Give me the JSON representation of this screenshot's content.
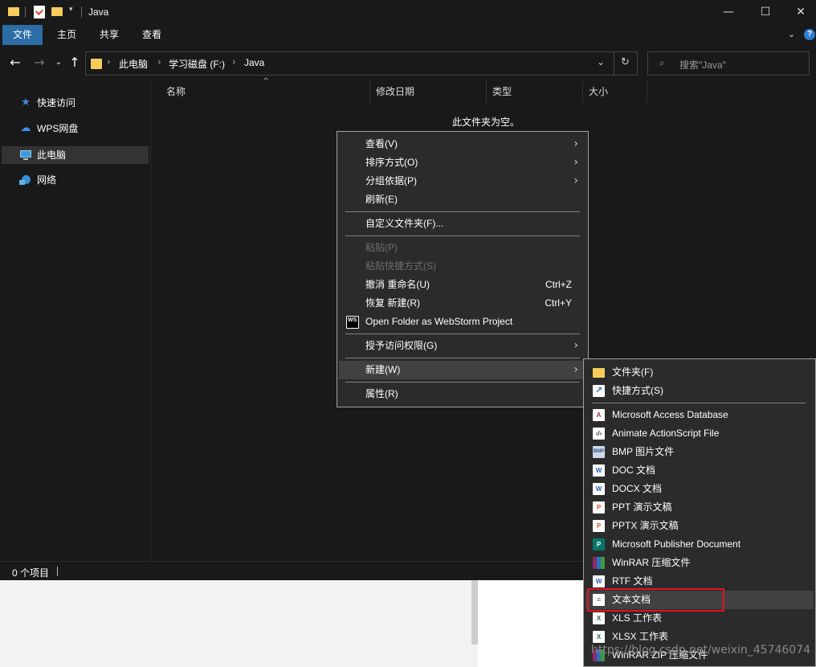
{
  "window": {
    "title": "Java"
  },
  "window_controls": {
    "minimize": "—",
    "maximize": "☐",
    "close": "✕"
  },
  "ribbon": {
    "tabs": [
      "文件",
      "主页",
      "共享",
      "查看"
    ]
  },
  "nav": {
    "breadcrumb": [
      "此电脑",
      "学习磁盘 (F:)",
      "Java"
    ],
    "search_placeholder": "搜索\"Java\""
  },
  "sidebar": {
    "items": [
      {
        "label": "快速访问",
        "icon": "star-icon"
      },
      {
        "label": "WPS网盘",
        "icon": "cloud-icon"
      },
      {
        "label": "此电脑",
        "icon": "computer-icon",
        "selected": true
      },
      {
        "label": "网络",
        "icon": "network-icon"
      }
    ]
  },
  "columns": [
    "名称",
    "修改日期",
    "类型",
    "大小"
  ],
  "empty_text": "此文件夹为空。",
  "status": {
    "count": "0 个项目"
  },
  "context_menu": {
    "items": [
      {
        "label": "查看(V)",
        "submenu": true
      },
      {
        "label": "排序方式(O)",
        "submenu": true
      },
      {
        "label": "分组依据(P)",
        "submenu": true
      },
      {
        "label": "刷新(E)"
      },
      {
        "label": "自定义文件夹(F)..."
      },
      {
        "label": "粘贴(P)",
        "disabled": true
      },
      {
        "label": "粘贴快捷方式(S)",
        "disabled": true
      },
      {
        "label": "撤消 重命名(U)",
        "shortcut": "Ctrl+Z"
      },
      {
        "label": "恢复 新建(R)",
        "shortcut": "Ctrl+Y"
      },
      {
        "label": "Open Folder as WebStorm Project",
        "icon": "webstorm-icon"
      },
      {
        "label": "授予访问权限(G)",
        "submenu": true
      },
      {
        "label": "新建(W)",
        "submenu": true,
        "highlighted": true
      },
      {
        "label": "属性(R)"
      }
    ]
  },
  "new_submenu": {
    "items": [
      {
        "label": "文件夹(F)",
        "icon": "folder-icon"
      },
      {
        "label": "快捷方式(S)",
        "icon": "shortcut-icon"
      },
      {
        "label": "Microsoft Access Database",
        "icon": "access-icon"
      },
      {
        "label": "Animate ActionScript File",
        "icon": "actionscript-icon"
      },
      {
        "label": "BMP 图片文件",
        "icon": "bmp-icon"
      },
      {
        "label": "DOC 文档",
        "icon": "doc-icon"
      },
      {
        "label": "DOCX 文档",
        "icon": "docx-icon"
      },
      {
        "label": "PPT 演示文稿",
        "icon": "ppt-icon"
      },
      {
        "label": "PPTX 演示文稿",
        "icon": "pptx-icon"
      },
      {
        "label": "Microsoft Publisher Document",
        "icon": "publisher-icon"
      },
      {
        "label": "WinRAR 压缩文件",
        "icon": "winrar-icon"
      },
      {
        "label": "RTF 文档",
        "icon": "rtf-icon"
      },
      {
        "label": "文本文档",
        "icon": "text-document-icon",
        "highlighted": true
      },
      {
        "label": "XLS 工作表",
        "icon": "xls-icon"
      },
      {
        "label": "XLSX 工作表",
        "icon": "xlsx-icon"
      },
      {
        "label": "WinRAR ZIP 压缩文件",
        "icon": "winrar-zip-icon"
      }
    ]
  },
  "watermark": "https://blog.csdn.net/weixin_45746074"
}
